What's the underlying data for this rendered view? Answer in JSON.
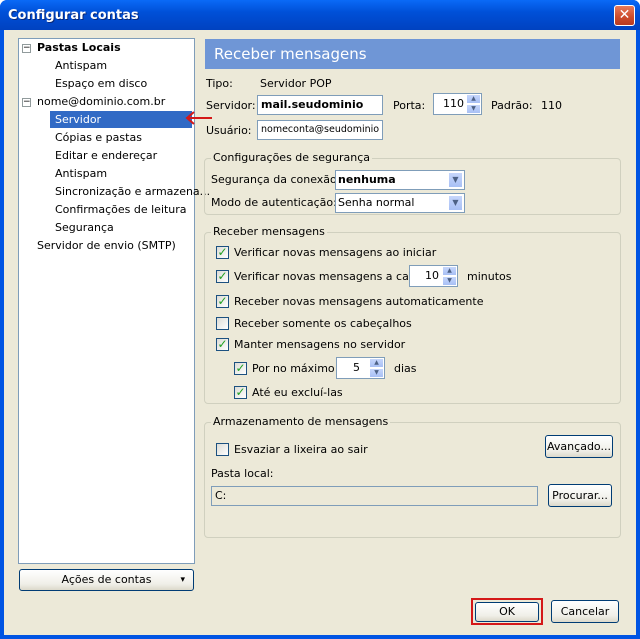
{
  "window": {
    "title": "Configurar contas",
    "close_glyph": "✕"
  },
  "tree": {
    "items": [
      {
        "label": "Pastas Locais",
        "toggle": "−"
      },
      {
        "label": "Antispam"
      },
      {
        "label": "Espaço em disco"
      },
      {
        "label": "nome@dominio.com.br",
        "toggle": "−"
      },
      {
        "label": "Servidor"
      },
      {
        "label": "Cópias e pastas"
      },
      {
        "label": "Editar e endereçar"
      },
      {
        "label": "Antispam"
      },
      {
        "label": "Sincronização e armazena..."
      },
      {
        "label": "Confirmações de leitura"
      },
      {
        "label": "Segurança"
      },
      {
        "label": "Servidor de envio (SMTP)"
      }
    ],
    "selected_index": 4
  },
  "account_actions": {
    "label": "Ações de contas",
    "glyph": "▾"
  },
  "panel": {
    "header": "Receber mensagens",
    "tipo_label": "Tipo:",
    "tipo_value": "Servidor POP",
    "servidor_label": "Servidor:",
    "servidor_value": "mail.seudominio",
    "porta_label": "Porta:",
    "porta_value": "110",
    "padrao_label": "Padrão:",
    "padrao_value": "110",
    "usuario_label": "Usuário:",
    "usuario_value": "nomeconta@seudominio"
  },
  "security": {
    "title": "Configurações de segurança",
    "conexao_label": "Segurança da conexão:",
    "conexao_value": "nenhuma",
    "autenticacao_label": "Modo de autenticação:",
    "autenticacao_value": "Senha normal"
  },
  "receive": {
    "title": "Receber mensagens",
    "check_startup": "Verificar novas mensagens ao iniciar",
    "check_every": "Verificar novas mensagens a cada",
    "interval_value": "10",
    "interval_unit": "minutos",
    "auto_download": "Receber novas mensagens automaticamente",
    "headers_only": "Receber somente os cabeçalhos",
    "leave_on_server": "Manter mensagens no servidor",
    "max_days": "Por no máximo",
    "days_value": "5",
    "days_unit": "dias",
    "until_deleted": "Até eu excluí-las"
  },
  "storage": {
    "title": "Armazenamento de mensagens",
    "empty_trash": "Esvaziar a lixeira ao sair",
    "advanced_button": "Avançado...",
    "local_folder_label": "Pasta local:",
    "local_folder_value": "C:",
    "browse_button": "Procurar..."
  },
  "footer": {
    "ok": "OK",
    "cancel": "Cancelar"
  },
  "check_glyph": "✓",
  "spin_up": "▲",
  "spin_down": "▼",
  "dropdown_glyph": "▼",
  "colors": {
    "selection": "#316ac5",
    "header": "#6f96d6",
    "highlight": "#d41818"
  }
}
